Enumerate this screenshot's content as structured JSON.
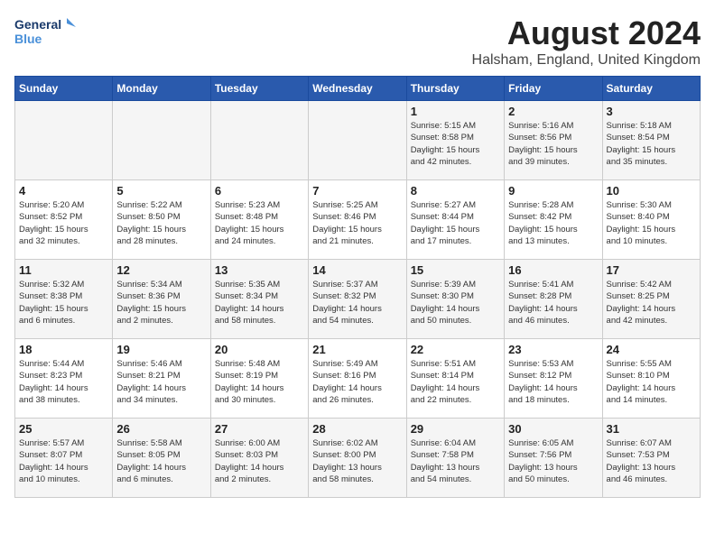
{
  "logo": {
    "line1": "General",
    "line2": "Blue"
  },
  "title": "August 2024",
  "location": "Halsham, England, United Kingdom",
  "weekdays": [
    "Sunday",
    "Monday",
    "Tuesday",
    "Wednesday",
    "Thursday",
    "Friday",
    "Saturday"
  ],
  "weeks": [
    [
      {
        "day": "",
        "info": ""
      },
      {
        "day": "",
        "info": ""
      },
      {
        "day": "",
        "info": ""
      },
      {
        "day": "",
        "info": ""
      },
      {
        "day": "1",
        "info": "Sunrise: 5:15 AM\nSunset: 8:58 PM\nDaylight: 15 hours\nand 42 minutes."
      },
      {
        "day": "2",
        "info": "Sunrise: 5:16 AM\nSunset: 8:56 PM\nDaylight: 15 hours\nand 39 minutes."
      },
      {
        "day": "3",
        "info": "Sunrise: 5:18 AM\nSunset: 8:54 PM\nDaylight: 15 hours\nand 35 minutes."
      }
    ],
    [
      {
        "day": "4",
        "info": "Sunrise: 5:20 AM\nSunset: 8:52 PM\nDaylight: 15 hours\nand 32 minutes."
      },
      {
        "day": "5",
        "info": "Sunrise: 5:22 AM\nSunset: 8:50 PM\nDaylight: 15 hours\nand 28 minutes."
      },
      {
        "day": "6",
        "info": "Sunrise: 5:23 AM\nSunset: 8:48 PM\nDaylight: 15 hours\nand 24 minutes."
      },
      {
        "day": "7",
        "info": "Sunrise: 5:25 AM\nSunset: 8:46 PM\nDaylight: 15 hours\nand 21 minutes."
      },
      {
        "day": "8",
        "info": "Sunrise: 5:27 AM\nSunset: 8:44 PM\nDaylight: 15 hours\nand 17 minutes."
      },
      {
        "day": "9",
        "info": "Sunrise: 5:28 AM\nSunset: 8:42 PM\nDaylight: 15 hours\nand 13 minutes."
      },
      {
        "day": "10",
        "info": "Sunrise: 5:30 AM\nSunset: 8:40 PM\nDaylight: 15 hours\nand 10 minutes."
      }
    ],
    [
      {
        "day": "11",
        "info": "Sunrise: 5:32 AM\nSunset: 8:38 PM\nDaylight: 15 hours\nand 6 minutes."
      },
      {
        "day": "12",
        "info": "Sunrise: 5:34 AM\nSunset: 8:36 PM\nDaylight: 15 hours\nand 2 minutes."
      },
      {
        "day": "13",
        "info": "Sunrise: 5:35 AM\nSunset: 8:34 PM\nDaylight: 14 hours\nand 58 minutes."
      },
      {
        "day": "14",
        "info": "Sunrise: 5:37 AM\nSunset: 8:32 PM\nDaylight: 14 hours\nand 54 minutes."
      },
      {
        "day": "15",
        "info": "Sunrise: 5:39 AM\nSunset: 8:30 PM\nDaylight: 14 hours\nand 50 minutes."
      },
      {
        "day": "16",
        "info": "Sunrise: 5:41 AM\nSunset: 8:28 PM\nDaylight: 14 hours\nand 46 minutes."
      },
      {
        "day": "17",
        "info": "Sunrise: 5:42 AM\nSunset: 8:25 PM\nDaylight: 14 hours\nand 42 minutes."
      }
    ],
    [
      {
        "day": "18",
        "info": "Sunrise: 5:44 AM\nSunset: 8:23 PM\nDaylight: 14 hours\nand 38 minutes."
      },
      {
        "day": "19",
        "info": "Sunrise: 5:46 AM\nSunset: 8:21 PM\nDaylight: 14 hours\nand 34 minutes."
      },
      {
        "day": "20",
        "info": "Sunrise: 5:48 AM\nSunset: 8:19 PM\nDaylight: 14 hours\nand 30 minutes."
      },
      {
        "day": "21",
        "info": "Sunrise: 5:49 AM\nSunset: 8:16 PM\nDaylight: 14 hours\nand 26 minutes."
      },
      {
        "day": "22",
        "info": "Sunrise: 5:51 AM\nSunset: 8:14 PM\nDaylight: 14 hours\nand 22 minutes."
      },
      {
        "day": "23",
        "info": "Sunrise: 5:53 AM\nSunset: 8:12 PM\nDaylight: 14 hours\nand 18 minutes."
      },
      {
        "day": "24",
        "info": "Sunrise: 5:55 AM\nSunset: 8:10 PM\nDaylight: 14 hours\nand 14 minutes."
      }
    ],
    [
      {
        "day": "25",
        "info": "Sunrise: 5:57 AM\nSunset: 8:07 PM\nDaylight: 14 hours\nand 10 minutes."
      },
      {
        "day": "26",
        "info": "Sunrise: 5:58 AM\nSunset: 8:05 PM\nDaylight: 14 hours\nand 6 minutes."
      },
      {
        "day": "27",
        "info": "Sunrise: 6:00 AM\nSunset: 8:03 PM\nDaylight: 14 hours\nand 2 minutes."
      },
      {
        "day": "28",
        "info": "Sunrise: 6:02 AM\nSunset: 8:00 PM\nDaylight: 13 hours\nand 58 minutes."
      },
      {
        "day": "29",
        "info": "Sunrise: 6:04 AM\nSunset: 7:58 PM\nDaylight: 13 hours\nand 54 minutes."
      },
      {
        "day": "30",
        "info": "Sunrise: 6:05 AM\nSunset: 7:56 PM\nDaylight: 13 hours\nand 50 minutes."
      },
      {
        "day": "31",
        "info": "Sunrise: 6:07 AM\nSunset: 7:53 PM\nDaylight: 13 hours\nand 46 minutes."
      }
    ]
  ]
}
